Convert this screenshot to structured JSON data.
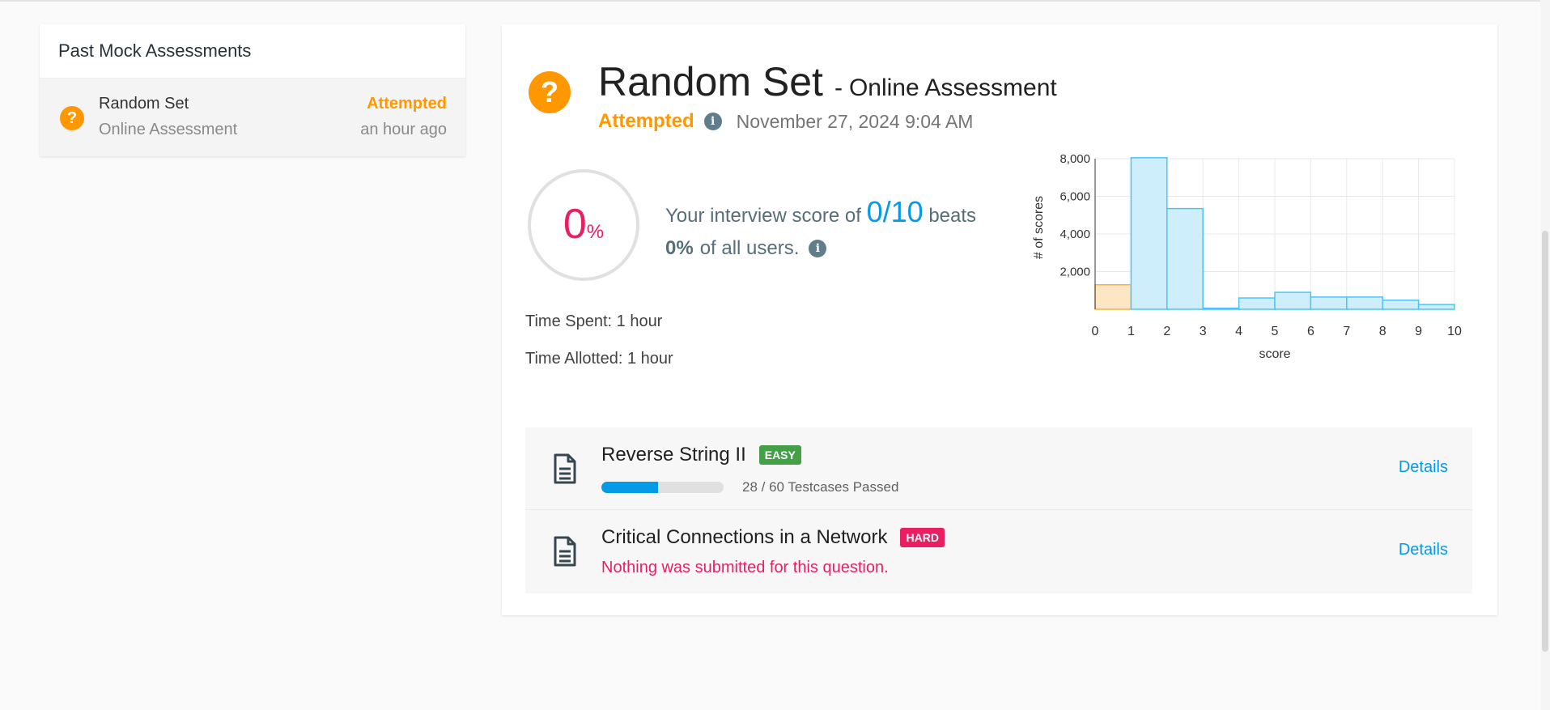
{
  "past_panel": {
    "header": "Past Mock Assessments",
    "items": [
      {
        "icon": "question-icon",
        "title": "Random Set",
        "subtitle": "Online Assessment",
        "status": "Attempted",
        "time": "an hour ago"
      }
    ]
  },
  "assessment": {
    "icon": "question-icon",
    "title": "Random Set",
    "separator": "-",
    "subtitle": "Online Assessment",
    "status": "Attempted",
    "date": "November 27, 2024 9:04 AM",
    "score_percent": "0",
    "score_percent_sign": "%",
    "score_text_prefix": "Your interview score of",
    "score_value": "0/10",
    "score_text_suffix": "beats",
    "beats_percent": "0%",
    "beats_suffix": "of all users.",
    "time_spent": "Time Spent: 1 hour",
    "time_allotted": "Time Allotted: 1 hour"
  },
  "questions": [
    {
      "title": "Reverse String II",
      "difficulty": "EASY",
      "progress_fraction": 0.4667,
      "progress_label": "28 / 60 Testcases Passed",
      "details": "Details"
    },
    {
      "title": "Critical Connections in a Network",
      "difficulty": "HARD",
      "error": "Nothing was submitted for this question.",
      "details": "Details"
    }
  ],
  "colors": {
    "accent_orange": "#ff9800",
    "score_pink": "#e91e63",
    "link_blue": "#039be5",
    "easy_green": "#43a047",
    "hard_pink": "#e91e63",
    "bar_fill": "#cdeefa",
    "bar_stroke": "#4fc3f7",
    "highlight_fill": "#fde6c4",
    "highlight_stroke": "#f5b041"
  },
  "chart_data": {
    "type": "bar",
    "xlabel": "score",
    "ylabel": "# of scores",
    "x_ticks": [
      "0",
      "1",
      "2",
      "3",
      "4",
      "5",
      "6",
      "7",
      "8",
      "9",
      "10"
    ],
    "y_ticks": [
      "2,000",
      "4,000",
      "6,000",
      "8,000"
    ],
    "xlim": [
      0,
      10
    ],
    "ylim": [
      0,
      8000
    ],
    "grid": true,
    "bins": [
      {
        "x0": 0,
        "x1": 1,
        "value": 1300,
        "highlight": true
      },
      {
        "x0": 1,
        "x1": 2,
        "value": 8050
      },
      {
        "x0": 2,
        "x1": 3,
        "value": 5350
      },
      {
        "x0": 3,
        "x1": 4,
        "value": 60
      },
      {
        "x0": 4,
        "x1": 5,
        "value": 600
      },
      {
        "x0": 5,
        "x1": 6,
        "value": 900
      },
      {
        "x0": 6,
        "x1": 7,
        "value": 650
      },
      {
        "x0": 7,
        "x1": 8,
        "value": 650
      },
      {
        "x0": 8,
        "x1": 9,
        "value": 480
      },
      {
        "x0": 9,
        "x1": 10,
        "value": 250
      }
    ]
  }
}
